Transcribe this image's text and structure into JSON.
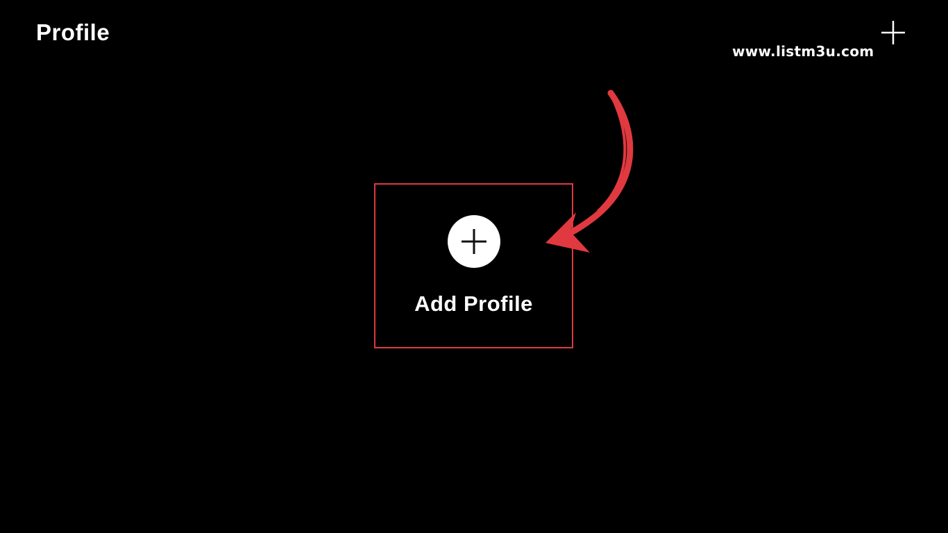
{
  "header": {
    "title": "Profile",
    "add_icon": "plus-icon"
  },
  "watermark": {
    "text": "www.listm3u.com"
  },
  "main": {
    "add_profile": {
      "label": "Add Profile",
      "icon": "plus-circle-icon"
    },
    "annotation": {
      "icon": "red-arrow-icon"
    }
  },
  "colors": {
    "background": "#000000",
    "text": "#ffffff",
    "highlight": "#e0393f"
  }
}
